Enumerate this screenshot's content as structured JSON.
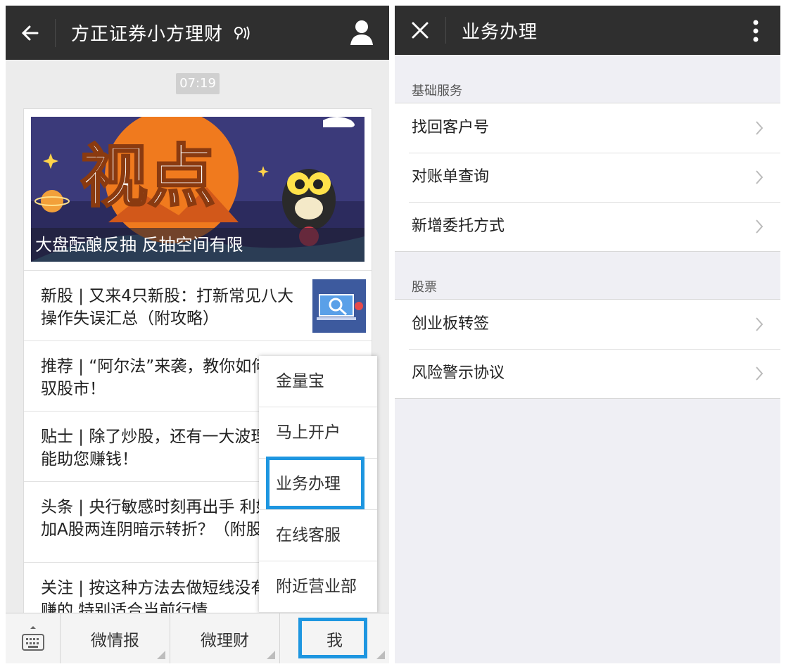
{
  "left": {
    "header": {
      "title": "方正证券小方理财"
    },
    "time_badge": "07:19",
    "banner": {
      "headline": "视点",
      "caption": "大盘酝酿反抽 反抽空间有限"
    },
    "articles": [
      {
        "text": "新股 | 又来4只新股：打新常见八大操作失误汇总（附攻略）"
      },
      {
        "text": "推荐 | “阿尔法”来袭，教你如何驾驭股市！"
      },
      {
        "text": "贴士 | 除了炒股，还有一大波理财能助您赚钱！"
      },
      {
        "text": "头条 | 央行敏感时刻再出手 利好叠加A股两连阴暗示转折？（附股）"
      },
      {
        "text": "关注 | 按这种方法去做短线没有不赚的 特别适合当前行情"
      }
    ],
    "popup_menu": {
      "items": [
        {
          "label": "金量宝"
        },
        {
          "label": "马上开户"
        },
        {
          "label": "业务办理"
        },
        {
          "label": "在线客服"
        },
        {
          "label": "附近营业部"
        }
      ],
      "highlighted_item": "业务办理"
    },
    "bottom_tabs": [
      {
        "label": "微情报"
      },
      {
        "label": "微理财"
      },
      {
        "label": "我"
      }
    ]
  },
  "right": {
    "header": {
      "title": "业务办理"
    },
    "sections": [
      {
        "label": "基础服务",
        "items": [
          {
            "label": "找回客户号"
          },
          {
            "label": "对账单查询"
          },
          {
            "label": "新增委托方式"
          }
        ]
      },
      {
        "label": "股票",
        "items": [
          {
            "label": "创业板转签"
          },
          {
            "label": "风险警示协议"
          }
        ]
      }
    ]
  },
  "colors": {
    "header_bg": "#2f2f2f",
    "highlight_border": "#1e96e0",
    "banner_orange": "#f07a1e",
    "banner_bg": "#3b3a7a"
  }
}
